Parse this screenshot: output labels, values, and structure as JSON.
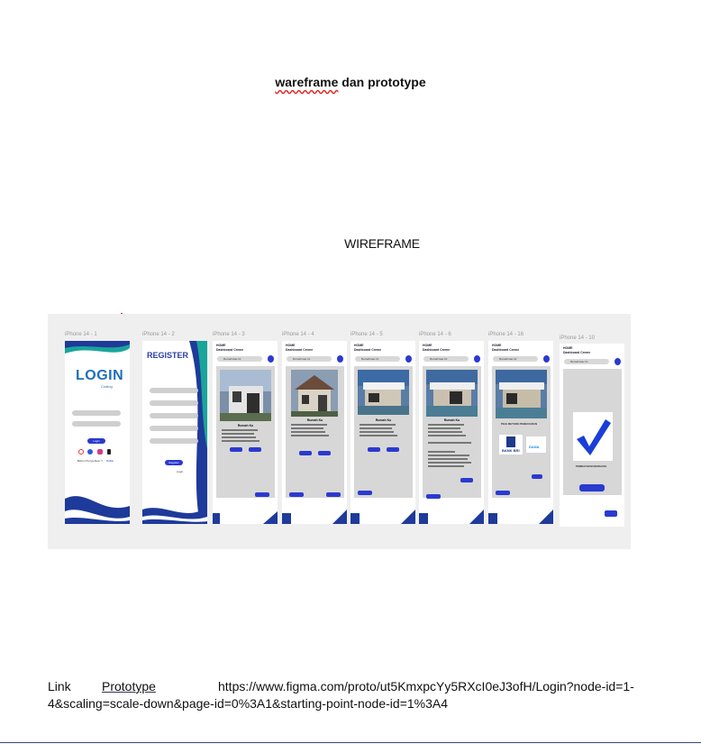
{
  "document": {
    "title_main": "wareframe",
    "title_rest": " dan prototype",
    "section_heading": "WIREFRAME",
    "link_label": "Link",
    "prototype_label": "Prototype",
    "url_part1": "https://www.figma.com/proto/ut5KmxpcYy5RXcI0eJ3ofH/Login?node-id=1-",
    "url_part2": "4&scaling=scale-down&page-id=0%3A1&starting-point-node-id=1%3A4"
  },
  "frames": [
    {
      "label": "iPhone 14 - 1"
    },
    {
      "label": "iPhone 14 - 2"
    },
    {
      "label": "iPhone 14 - 3"
    },
    {
      "label": "iPhone 14 - 4"
    },
    {
      "label": "iPhone 14 - 5"
    },
    {
      "label": "iPhone 14 - 6"
    },
    {
      "label": "iPhone 14 - 16"
    },
    {
      "label": "iPhone 14 - 10"
    }
  ],
  "login": {
    "logo": "LOGIN",
    "sub": "Coding",
    "button": "Login",
    "footer_a": "Belum Punya Akun ?",
    "footer_b": "Daftar"
  },
  "register": {
    "title": "REGISTER",
    "button": "Register",
    "footer_b": "Login"
  },
  "dashboard": {
    "home": "HOME",
    "sub": "Dashboard Creme",
    "search": "Rumah kau Ini",
    "card_title": "Rumah Ku"
  },
  "payment": {
    "title": "PILIH METODE PEMBAYARAN",
    "bank_a": "BANK BRI",
    "bank_b": "DANA"
  },
  "success": {
    "text": "PEMBAYARAN BERHASIL"
  },
  "colors": {
    "accent": "#2b3ad0",
    "wave": "#1e3a9a",
    "teal": "#1aa59a",
    "logo": "#1e6fb8"
  }
}
